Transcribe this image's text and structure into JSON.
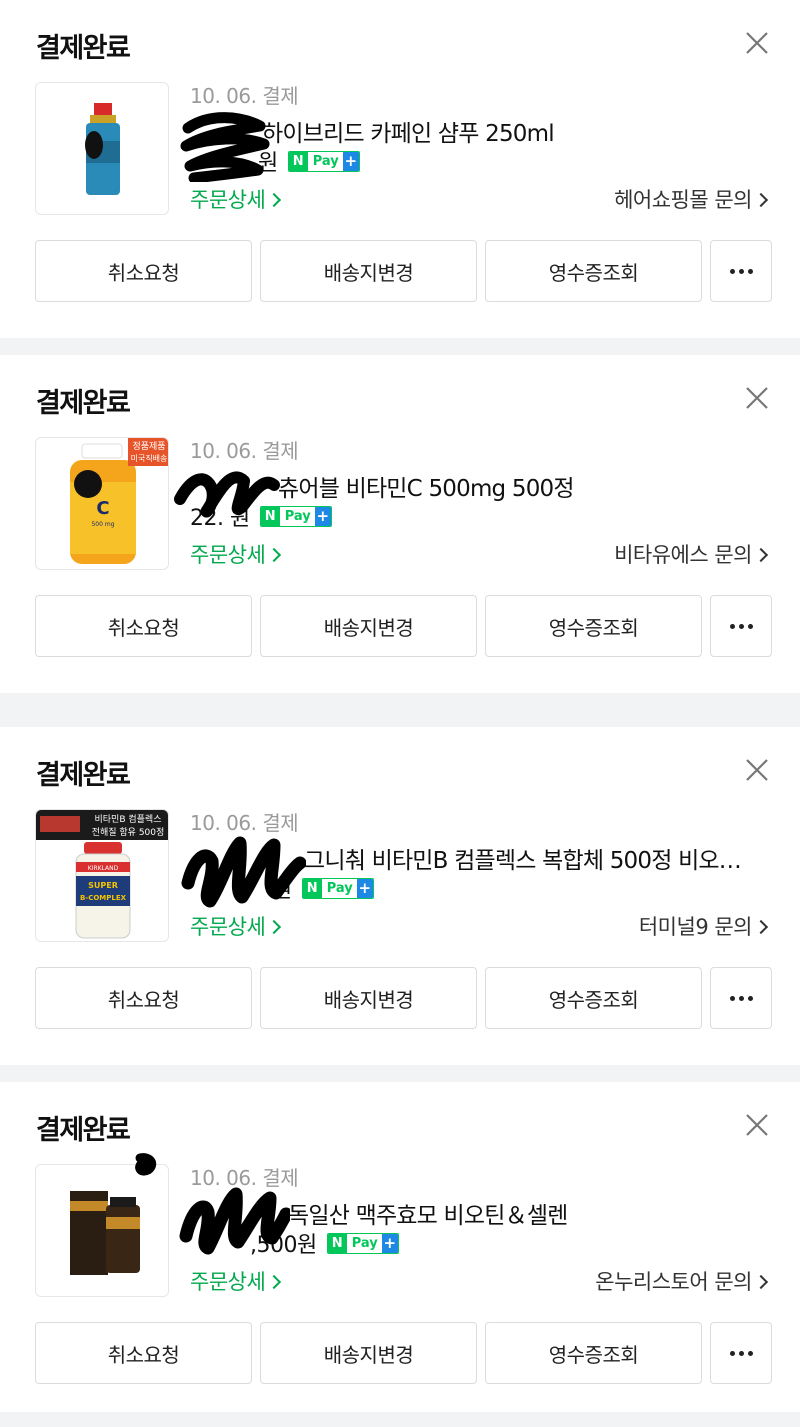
{
  "orders": [
    {
      "status": "결제완료",
      "date": "10. 06. 결제",
      "product_name": "하이브리드 카페인 샴푸 250ml",
      "price": "원",
      "detail_label": "주문상세",
      "seller_inquiry": "헤어쇼핑몰 문의",
      "thumb": "shampoo-bottle"
    },
    {
      "status": "결제완료",
      "date": "10. 06. 결제",
      "product_name": "츄어블 비타민C 500mg 500정",
      "price": "22.    원",
      "detail_label": "주문상세",
      "seller_inquiry": "비타유에스 문의",
      "thumb": "vitamin-c-bottle",
      "thumb_tag_line1": "정품제품",
      "thumb_tag_line2": "미국직배송",
      "thumb_bottle_label": "C",
      "thumb_bottle_sub": "500 mg"
    },
    {
      "status": "결제완료",
      "date": "10. 06. 결제",
      "product_name": "그니춰 비타민B 컴플렉스 복합체 500정 비오…",
      "price": "원",
      "detail_label": "주문상세",
      "seller_inquiry": "터미널9 문의",
      "thumb": "b-complex-bottle",
      "thumb_banner_line1": "비타민B 컴플렉스",
      "thumb_banner_line2": "전해질 함유 500정",
      "thumb_bottle_brand": "KIRKLAND",
      "thumb_bottle_label1": "SUPER",
      "thumb_bottle_label2": "B-COMPLEX"
    },
    {
      "status": "결제완료",
      "date": "10. 06. 결제",
      "product_name": "독일산 맥주효모 비오틴＆셀렌",
      "price": ",500원",
      "detail_label": "주문상세",
      "seller_inquiry": "온누리스토어 문의",
      "thumb": "yeast-supplement-box"
    }
  ],
  "npay": {
    "n": "N",
    "label": "Pay",
    "plus": "+"
  },
  "actions": {
    "cancel": "취소요청",
    "change_address": "배송지변경",
    "receipt": "영수증조회"
  },
  "colors": {
    "accent_green": "#03a94e",
    "npay_green": "#03c75a",
    "npay_blue": "#1e88e5",
    "gap_gray": "#f2f3f5"
  }
}
